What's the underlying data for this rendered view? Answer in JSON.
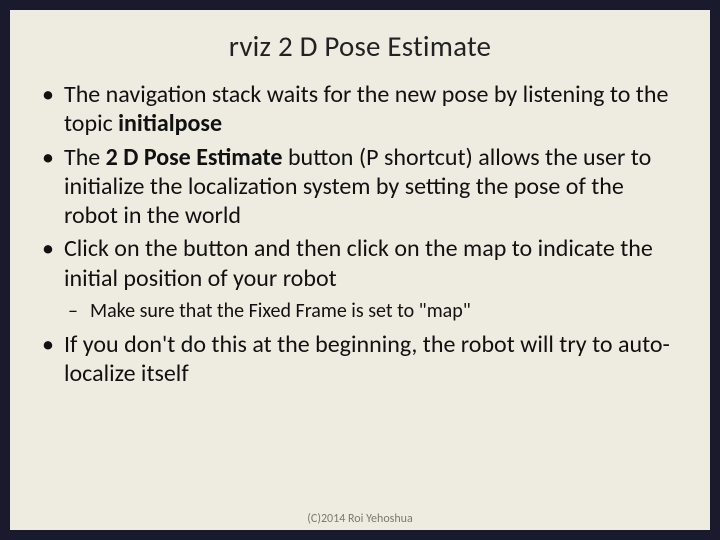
{
  "title": "rviz 2 D Pose Estimate",
  "bullets": {
    "b1_pre": "The navigation stack waits for the new pose by listening to the topic ",
    "b1_bold": "initialpose",
    "b2_pre": "The ",
    "b2_bold": "2 D Pose Estimate",
    "b2_post": " button (P shortcut) allows the user to initialize the localization system by setting the pose of the robot in the world",
    "b3": "Click on the button and then click on the map to indicate the initial position of your robot",
    "b3_sub": "Make sure that the Fixed Frame is set to \"map\"",
    "b4": "If you don't do this at the beginning, the robot will try to auto-localize itself"
  },
  "footer": "(C)2014 Roi Yehoshua"
}
